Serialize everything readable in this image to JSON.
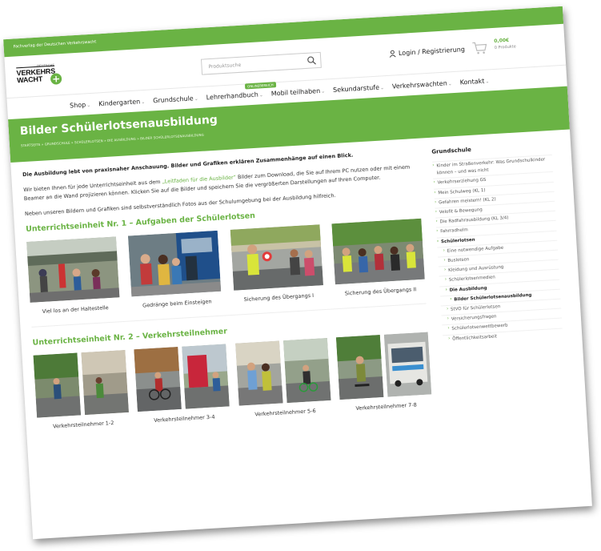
{
  "topbar": {
    "text": "Fachverlag der Deutschen Verkehrswacht"
  },
  "logo": {
    "small": "DEUTSCHE",
    "line1": "VERKEHRS",
    "line2": "WACHT"
  },
  "search": {
    "placeholder": "Produktsuche"
  },
  "header": {
    "login": "Login / Registrierung",
    "cart_total": "0,00€",
    "cart_count": "0 Produkte"
  },
  "nav": {
    "items": [
      "Shop",
      "Kindergarten",
      "Grundschule",
      "Lehrerhandbuch",
      "Mobil teilhaben",
      "Sekundarstufe",
      "Verkehrswachten",
      "Kontakt"
    ],
    "new_badge": "ONLINEBEREICH"
  },
  "banner": {
    "title": "Bilder Schülerlotsenausbildung",
    "breadcrumb": "STARTSEITE » GRUNDSCHULE » SCHÜLERLOTSEN » DIE AUSBILDUNG » BILDER SCHÜLERLOTSENAUSBILDUNG"
  },
  "main": {
    "lead": "Die Ausbildung lebt von praxisnaher Anschauung. Bilder und Grafiken erklären Zusammenhänge auf einen Blick.",
    "p1_a": "Wir bieten Ihnen für jede Unterrichtseinheit aus dem ",
    "p1_link": "„Leitfaden für die Ausbilder“",
    "p1_b": " Bilder zum Download, die Sie auf Ihrem PC nutzen oder mit einem Beamer an die Wand projizieren können. Klicken Sie auf die Bilder und speichern Sie die vergrößerten Darstellungen auf Ihren Computer.",
    "p2": "Neben unseren Bildern und Grafiken sind selbstverständlich Fotos aus der Schulumgebung bei der Ausbildung hilfreich.",
    "section1": {
      "title": "Unterrichtseinheit Nr. 1 – Aufgaben der Schülerlotsen",
      "captions": [
        "Viel los an der Haltestelle",
        "Gedränge beim Einsteigen",
        "Sicherung des Übergangs I",
        "Sicherung des Übergangs II"
      ]
    },
    "section2": {
      "title": "Unterrichtseinheit Nr. 2 – Verkehrsteilnehmer",
      "captions": [
        "Verkehrsteilnehmer 1-2",
        "Verkehrsteilnehmer 3-4",
        "Verkehrsteilnehmer 5-6",
        "Verkehrsteilnehmer 7-8"
      ]
    }
  },
  "sidebar": {
    "title": "Grundschule",
    "items": [
      "Kinder im Straßenverkehr: Was Grundschulkinder können – und was nicht",
      "Verkehrserziehung GS",
      "Mein Schulweg (KL 1)",
      "Gefahren meistern! (KL 2)",
      "Velofit & Bewegung",
      "Die Radfahrausbildung (KL 3/4)",
      "Fahrradhelm",
      "Schülerlotsen",
      "Eine notwendige Aufgabe",
      "Buslotsen",
      "Kleidung und Ausrüstung",
      "Schülerlotsenmedien",
      "Die Ausbildung",
      "Bilder Schülerlotsenausbildung",
      "StVO für Schülerlotsen",
      "Versicherungsfragen",
      "Schülerlotsenwettbewerb",
      "Öffentlichkeitsarbeit"
    ]
  },
  "colors": {
    "accent": "#6ab344"
  }
}
